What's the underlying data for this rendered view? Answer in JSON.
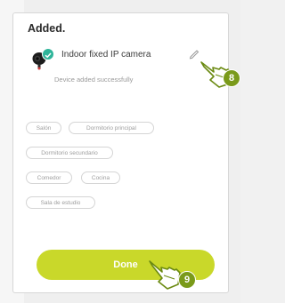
{
  "dialog": {
    "title": "Added.",
    "device_name": "Indoor fixed IP camera",
    "status_text": "Device added successfully"
  },
  "rooms": [
    "Salón",
    "Dormitorio principal",
    "Dormitorio secundario",
    "Comedor",
    "Cocina",
    "Sala de estudio"
  ],
  "done_label": "Done",
  "steps": {
    "edit_step": "8",
    "done_step": "9"
  },
  "colors": {
    "accent": "#c9d82a",
    "step_badge": "#7a9a1a",
    "check": "#2fb59a"
  },
  "icons": [
    "camera-icon",
    "check-icon",
    "edit-pencil-icon",
    "pointing-hand-icon"
  ]
}
